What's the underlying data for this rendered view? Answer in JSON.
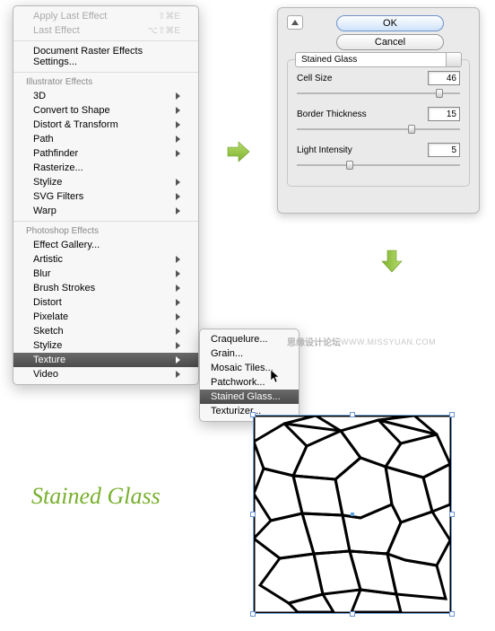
{
  "menu": {
    "apply_last": "Apply Last Effect",
    "apply_shortcut": "⇧⌘E",
    "last_effect": "Last Effect",
    "last_shortcut": "⌥⇧⌘E",
    "doc_raster": "Document Raster Effects Settings...",
    "section_illustrator": "Illustrator Effects",
    "illustrator": [
      "3D",
      "Convert to Shape",
      "Distort & Transform",
      "Path",
      "Pathfinder",
      "Rasterize...",
      "Stylize",
      "SVG Filters",
      "Warp"
    ],
    "section_photoshop": "Photoshop Effects",
    "effect_gallery": "Effect Gallery...",
    "photoshop": [
      "Artistic",
      "Blur",
      "Brush Strokes",
      "Distort",
      "Pixelate",
      "Sketch",
      "Stylize",
      "Texture",
      "Video"
    ]
  },
  "submenu": {
    "items": [
      "Craquelure...",
      "Grain...",
      "Mosaic Tiles...",
      "Patchwork...",
      "Stained Glass...",
      "Texturizer..."
    ]
  },
  "dialog": {
    "ok": "OK",
    "cancel": "Cancel",
    "group_title": "Stained Glass",
    "params": [
      {
        "label": "Cell Size",
        "value": "46",
        "thumb": 85
      },
      {
        "label": "Border Thickness",
        "value": "15",
        "thumb": 68
      },
      {
        "label": "Light Intensity",
        "value": "5",
        "thumb": 30
      }
    ]
  },
  "label": "Stained Glass",
  "watermark": {
    "cn": "思缘设计论坛",
    "url": "WWW.MISSYUAN.COM"
  }
}
